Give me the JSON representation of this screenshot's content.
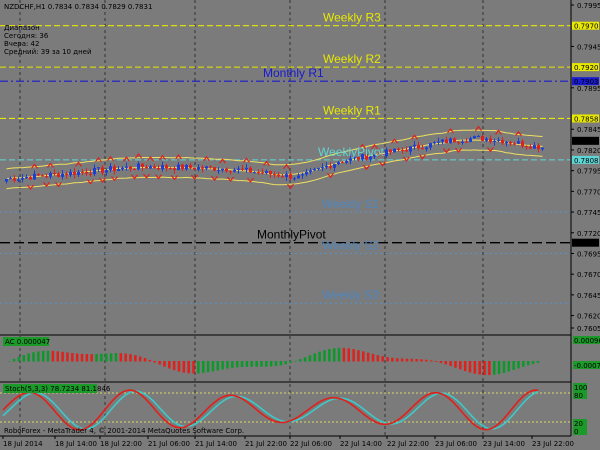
{
  "header": {
    "symbol_line": "NZDCHF,H1  0.7834 0.7834 0.7829 0.7831",
    "info_lines": [
      "Диапазон",
      "Сегодня:   36",
      "Вчера:     42",
      "Средний:   39 за 10 дней"
    ]
  },
  "levels": [
    {
      "name": "Weekly R3",
      "price": 0.797,
      "color": "#e8e800",
      "style": "dash",
      "label_color": "#e8e800",
      "tag": "0.7970"
    },
    {
      "name": "Weekly R2",
      "price": 0.792,
      "color": "#e8e800",
      "style": "dash",
      "label_color": "#e8e800",
      "tag": "0.7920"
    },
    {
      "name": "Monthly R1",
      "price": 0.7903,
      "color": "#1a1ad0",
      "style": "dashdot",
      "label_color": "#1a1ad0",
      "tag": "0.7903"
    },
    {
      "name": "Weekly R1",
      "price": 0.7858,
      "color": "#e8e800",
      "style": "dash",
      "label_color": "#e8e800",
      "tag": "0.7858"
    },
    {
      "name": "WeeklyPivot",
      "price": 0.7808,
      "color": "#5fd6d6",
      "style": "dash",
      "label_color": "#5fd6d6",
      "tag": "0.7808"
    },
    {
      "name": "Weekly S1",
      "price": 0.7745,
      "color": "#5b8fc4",
      "style": "dot",
      "label_color": "#4f87c0",
      "tag": ""
    },
    {
      "name": "MonthlyPivot",
      "price": 0.7708,
      "color": "#000000",
      "style": "longdash",
      "label_color": "#000000",
      "tag": "0.7708"
    },
    {
      "name": "Weekly S2",
      "price": 0.7695,
      "color": "#5b8fc4",
      "style": "dot",
      "label_color": "#4f87c0",
      "tag": ""
    },
    {
      "name": "Weekly S3",
      "price": 0.7635,
      "color": "#5b8fc4",
      "style": "dot",
      "label_color": "#4f87c0",
      "tag": ""
    }
  ],
  "current_price_tag": "0.7831",
  "price_axis": {
    "ticks": [
      "0.7995",
      "0.7945",
      "0.7895",
      "0.7845",
      "0.7820",
      "0.7795",
      "0.7770",
      "0.7745",
      "0.7720",
      "0.7695",
      "0.7670",
      "0.7645",
      "0.7620",
      "0.7605"
    ]
  },
  "time_axis": {
    "labels": [
      "18 Jul 2014",
      "18 Jul 14:00",
      "18 Jul 22:00",
      "21 Jul 06:00",
      "21 Jul 14:00",
      "21 Jul 22:00",
      "22 Jul 06:00",
      "22 Jul 14:00",
      "22 Jul 22:00",
      "23 Jul 06:00",
      "23 Jul 14:00",
      "23 Jul 22:00"
    ]
  },
  "ac_panel": {
    "label": "AC 0.000047",
    "scale_top": "0.000964",
    "scale_bottom": "-0.000723"
  },
  "stoch_panel": {
    "label": "Stoch(5,3,3) 78.7234 81.1846",
    "scale_top": "100",
    "scale_80": "80",
    "scale_20": "20",
    "scale_bottom": "0"
  },
  "copyright": "RoboForex - MetaTrader 4, © 2001-2014 MetaQuotes Software Corp.",
  "colors": {
    "background": "#7b7b7b",
    "bull_candle": "#1b3fd6",
    "bear_candle": "#e0201a",
    "envelope": "#f0e060",
    "ac_up": "#0a9a2a",
    "ac_down": "#e0201a",
    "stoch_main": "#e0201a",
    "stoch_signal": "#3fc8c8"
  }
}
